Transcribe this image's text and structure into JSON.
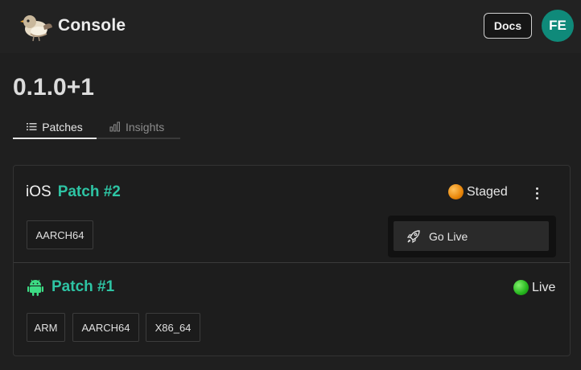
{
  "header": {
    "app_title": "Console",
    "docs_label": "Docs",
    "avatar_initials": "FE"
  },
  "release": {
    "version": "0.1.0+1"
  },
  "tabs": [
    {
      "label": "Patches",
      "icon": "list-icon",
      "active": true
    },
    {
      "label": "Insights",
      "icon": "bar-chart-icon",
      "active": false
    }
  ],
  "patches": [
    {
      "platform": "iOS",
      "name": "Patch #2",
      "status": "Staged",
      "status_color": "#f29a12",
      "architectures": [
        "AARCH64"
      ],
      "menu": {
        "items": [
          {
            "label": "Go Live",
            "icon": "rocket-icon"
          }
        ]
      }
    },
    {
      "platform_icon": "android-icon",
      "name": "Patch #1",
      "status": "Live",
      "status_color": "#2dbf22",
      "architectures": [
        "ARM",
        "AARCH64",
        "X86_64"
      ]
    }
  ],
  "colors": {
    "accent": "#2ec4a4",
    "avatar": "#0f8a7a",
    "background": "#1f1f1f"
  }
}
